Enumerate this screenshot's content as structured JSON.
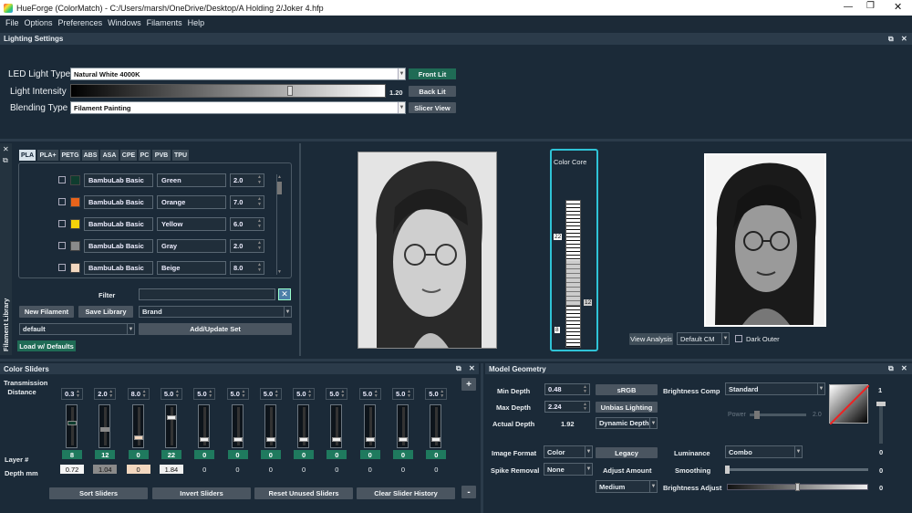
{
  "window": {
    "app_icon": "hueforge-icon",
    "title": "HueForge (ColorMatch) - C:/Users/marsh/OneDrive/Desktop/A Holding 2/Joker 4.hfp"
  },
  "menu": [
    "File",
    "Options",
    "Preferences",
    "Windows",
    "Filaments",
    "Help"
  ],
  "lighting": {
    "title": "Lighting Settings",
    "led_label": "LED Light Type",
    "led_value": "Natural White 4000K",
    "intensity_label": "Light Intensity",
    "intensity_value": "1.20",
    "intensity_fraction": 0.71,
    "blending_label": "Blending Type",
    "blending_value": "Filament Painting",
    "buttons": [
      "Front Lit",
      "Back Lit",
      "Slicer View"
    ]
  },
  "library": {
    "side_title": "Filament Library",
    "tabs": [
      "PLA",
      "PLA+",
      "PETG",
      "ABS",
      "ASA",
      "CPE",
      "PC",
      "PVB",
      "TPU"
    ],
    "rows": [
      {
        "brand": "BambuLab Basic",
        "name": "Green",
        "td": "2.0",
        "color": "#0f3d2f"
      },
      {
        "brand": "BambuLab Basic",
        "name": "Orange",
        "td": "7.0",
        "color": "#e8641b"
      },
      {
        "brand": "BambuLab Basic",
        "name": "Yellow",
        "td": "6.0",
        "color": "#f5d20a"
      },
      {
        "brand": "BambuLab Basic",
        "name": "Gray",
        "td": "2.0",
        "color": "#8a8a8a"
      },
      {
        "brand": "BambuLab Basic",
        "name": "Beige",
        "td": "8.0",
        "color": "#f2d7bf"
      }
    ],
    "filter_label": "Filter",
    "filter_value": "",
    "new_button": "New Filament",
    "save_button": "Save Library",
    "brand_select": "Brand",
    "set_select": "default",
    "add_update_button": "Add/Update Set",
    "load_defaults_button": "Load w/ Defaults"
  },
  "preview": {
    "color_core_label": "Color Core",
    "marker_top": "22",
    "marker_mid": "12",
    "marker_bottom": "8",
    "view_analysis_button": "View Analysis",
    "cm_select": "Default CM",
    "dark_outer_label": "Dark Outer"
  },
  "sliders": {
    "title": "Color Sliders",
    "transmission_label": "Transmission Distance",
    "layer_label": "Layer #",
    "depth_label": "Depth mm",
    "td_values": [
      "0.3",
      "2.0",
      "8.0",
      "5.0",
      "5.0",
      "5.0",
      "5.0",
      "5.0",
      "5.0",
      "5.0",
      "5.0",
      "5.0"
    ],
    "colors": [
      "#0f3d2f",
      "#8a8a8a",
      "#f2d7bf",
      "#f0f0f0",
      "#f0f0f0",
      "#f0f0f0",
      "#f0f0f0",
      "#f0f0f0",
      "#f0f0f0",
      "#f0f0f0",
      "#f0f0f0",
      "#f0f0f0"
    ],
    "levels": [
      0.37,
      0.55,
      0.8,
      0.22,
      0.85,
      0.85,
      0.85,
      0.85,
      0.85,
      0.85,
      0.85,
      0.85
    ],
    "layers": [
      "8",
      "12",
      "0",
      "22",
      "0",
      "0",
      "0",
      "0",
      "0",
      "0",
      "0",
      "0"
    ],
    "depths": [
      "0.72",
      "1.04",
      "0",
      "1.84",
      "0",
      "0",
      "0",
      "0",
      "0",
      "0",
      "0",
      "0"
    ],
    "buttons": [
      "Sort Sliders",
      "Invert Sliders",
      "Reset Unused Sliders",
      "Clear Slider History"
    ],
    "plus": "+",
    "minus": "-"
  },
  "geometry": {
    "title": "Model Geometry",
    "min_depth_label": "Min Depth",
    "min_depth": "0.48",
    "max_depth_label": "Max Depth",
    "max_depth": "2.24",
    "actual_depth_label": "Actual Depth",
    "actual_depth": "1.92",
    "srgb_button": "sRGB",
    "unbias_button": "Unbias Lighting",
    "dynamic_depth": "Dynamic Depth",
    "brightness_comp_label": "Brightness Comp",
    "brightness_comp": "Standard",
    "power_label": "Power",
    "power_value": "2.0",
    "image_format_label": "Image Format",
    "image_format": "Color",
    "legacy_button": "Legacy",
    "luminance_label": "Luminance",
    "luminance": "Combo",
    "spike_label": "Spike Removal",
    "spike": "None",
    "adjust_label": "Adjust Amount",
    "adjust": "Medium",
    "smoothing_label": "Smoothing",
    "smoothing_value": "0",
    "brightness_adjust_label": "Brightness Adjust",
    "brightness_adjust_value": "0",
    "vslider_top": "1",
    "vslider_bottom": "0"
  }
}
